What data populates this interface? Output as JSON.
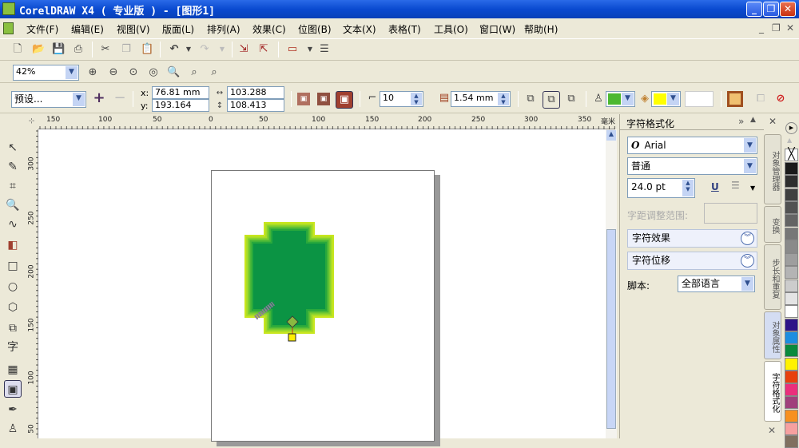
{
  "window": {
    "title": "CorelDRAW X4 ( 专业版 ) - [图形1]",
    "minimize": "_",
    "restore": "❐",
    "close": "✕"
  },
  "menu": [
    {
      "label": "文件(F)"
    },
    {
      "label": "编辑(E)"
    },
    {
      "label": "视图(V)"
    },
    {
      "label": "版面(L)"
    },
    {
      "label": "排列(A)"
    },
    {
      "label": "效果(C)"
    },
    {
      "label": "位图(B)"
    },
    {
      "label": "文本(X)"
    },
    {
      "label": "表格(T)"
    },
    {
      "label": "工具(O)"
    },
    {
      "label": "窗口(W)"
    },
    {
      "label": "帮助(H)"
    }
  ],
  "doc_controls": {
    "minimize": "_",
    "restore": "❐",
    "close": "✕"
  },
  "zoom": {
    "value": "42%"
  },
  "property_bar": {
    "preset": "预设...",
    "x_label": "x:",
    "x": "76.81 mm",
    "y_label": "y:",
    "y": "193.164 mm",
    "width": "103.288 mm",
    "height": "108.413 mm",
    "steps": "10",
    "offset": "1.54 mm",
    "outline_color": "#4cb830",
    "fill_color": "#ffff00"
  },
  "ruler": {
    "unit": "毫米",
    "h_labels": [
      "150",
      "100",
      "50",
      "0",
      "50",
      "100",
      "150",
      "200",
      "250",
      "300",
      "350"
    ],
    "v_labels": [
      "300",
      "250",
      "200",
      "150",
      "100",
      "50"
    ]
  },
  "docker": {
    "title": "字符格式化",
    "font": "Arial",
    "style": "普通",
    "size": "24.0 pt",
    "kerning_label": "字距调整范围:",
    "effects": "字符效果",
    "shift": "字符位移",
    "script_label": "脚本:",
    "script_value": "全部语言"
  },
  "side_tabs": [
    "对象管理器",
    "变换",
    "步长和重复",
    "对象属性",
    "字符格式化"
  ],
  "palette": [
    "#1a1a1a",
    "#2e2e2e",
    "#404040",
    "#525252",
    "#646464",
    "#777777",
    "#8a8a8a",
    "#9e9e9e",
    "#b4b4b4",
    "#cccccc",
    "#e4e4e4",
    "#ffffff",
    "#2e1488",
    "#1c8ee0",
    "#0a8a3c",
    "#fff200",
    "#e8400c",
    "#ea2f7c",
    "#a0407c",
    "#f7901e",
    "#f6a0a0",
    "#807060"
  ],
  "shape": {
    "fill": "#0b9444",
    "outline": "#c8e61e"
  },
  "toolbox_text_tool": "字"
}
